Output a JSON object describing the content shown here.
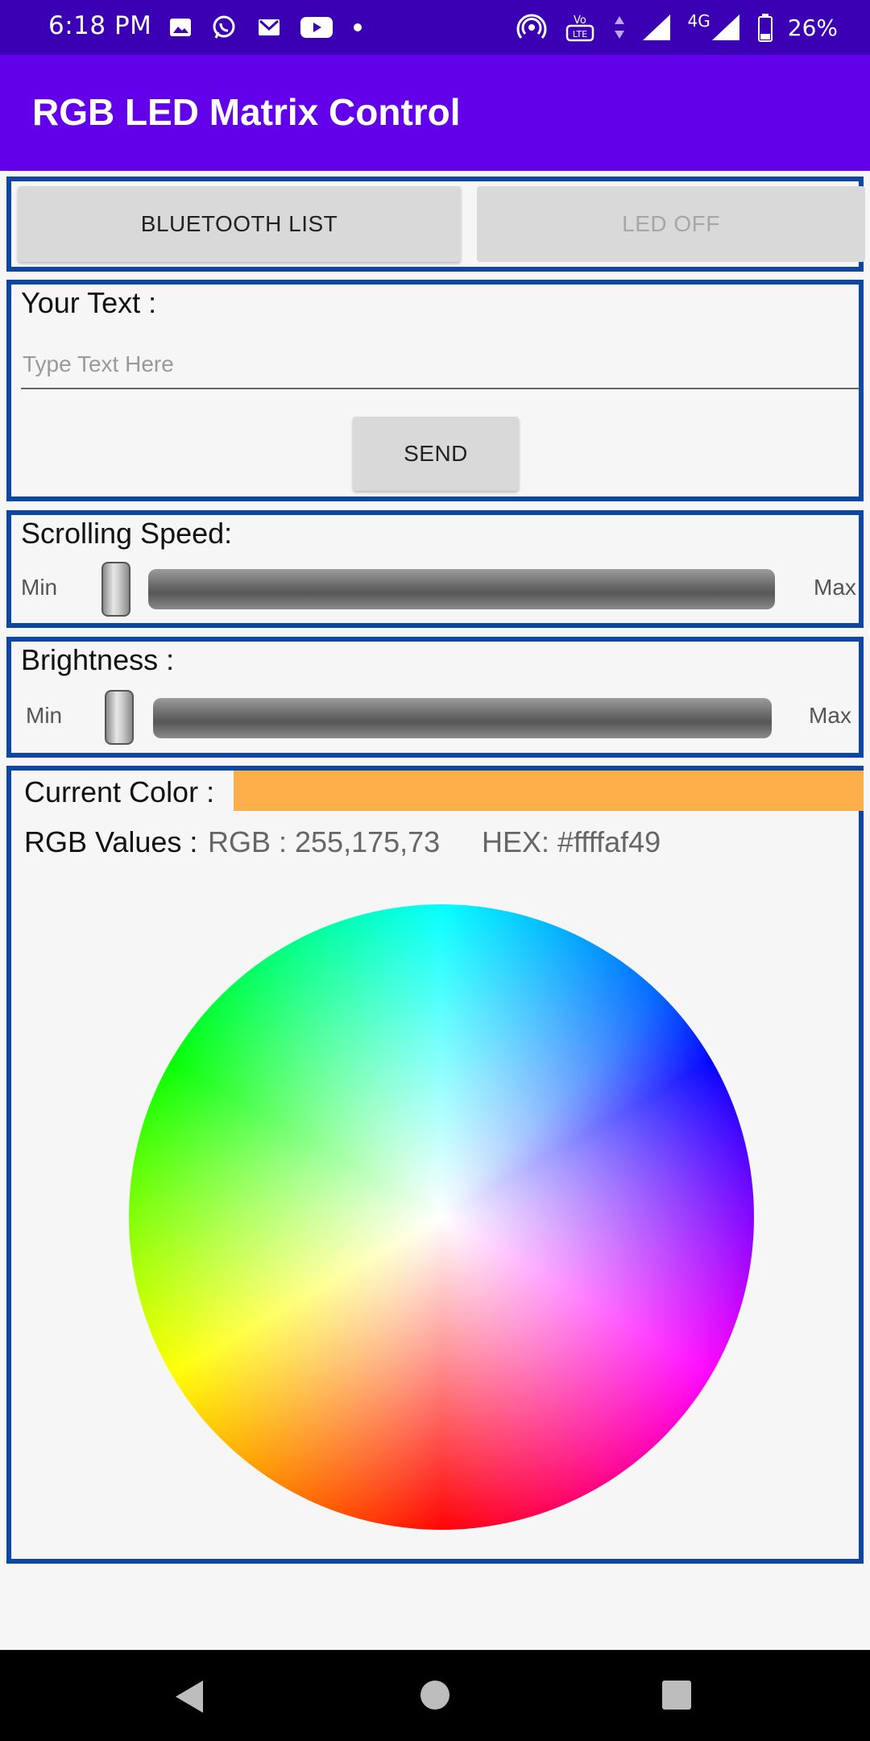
{
  "status_bar": {
    "time": "6:18 PM",
    "network": "4G",
    "battery": "26%"
  },
  "app_bar": {
    "title": "RGB LED Matrix Control"
  },
  "controls": {
    "bluetooth_label": "BLUETOOTH LIST",
    "led_off_label": "LED OFF"
  },
  "text_section": {
    "label": "Your Text :",
    "placeholder": "Type Text Here",
    "send_label": "SEND"
  },
  "speed": {
    "label": "Scrolling Speed:",
    "min": "Min",
    "max": "Max",
    "value_fraction": 0.0
  },
  "brightness": {
    "label": "Brightness :",
    "min": "Min",
    "max": "Max",
    "value_fraction": 0.0
  },
  "color": {
    "current_label": "Current Color :",
    "current_hex": "#ffaf49",
    "rgb_label": "RGB Values :",
    "rgb_text": "RGB : 255,175,73",
    "hex_text": "HEX: #ffffaf49"
  }
}
